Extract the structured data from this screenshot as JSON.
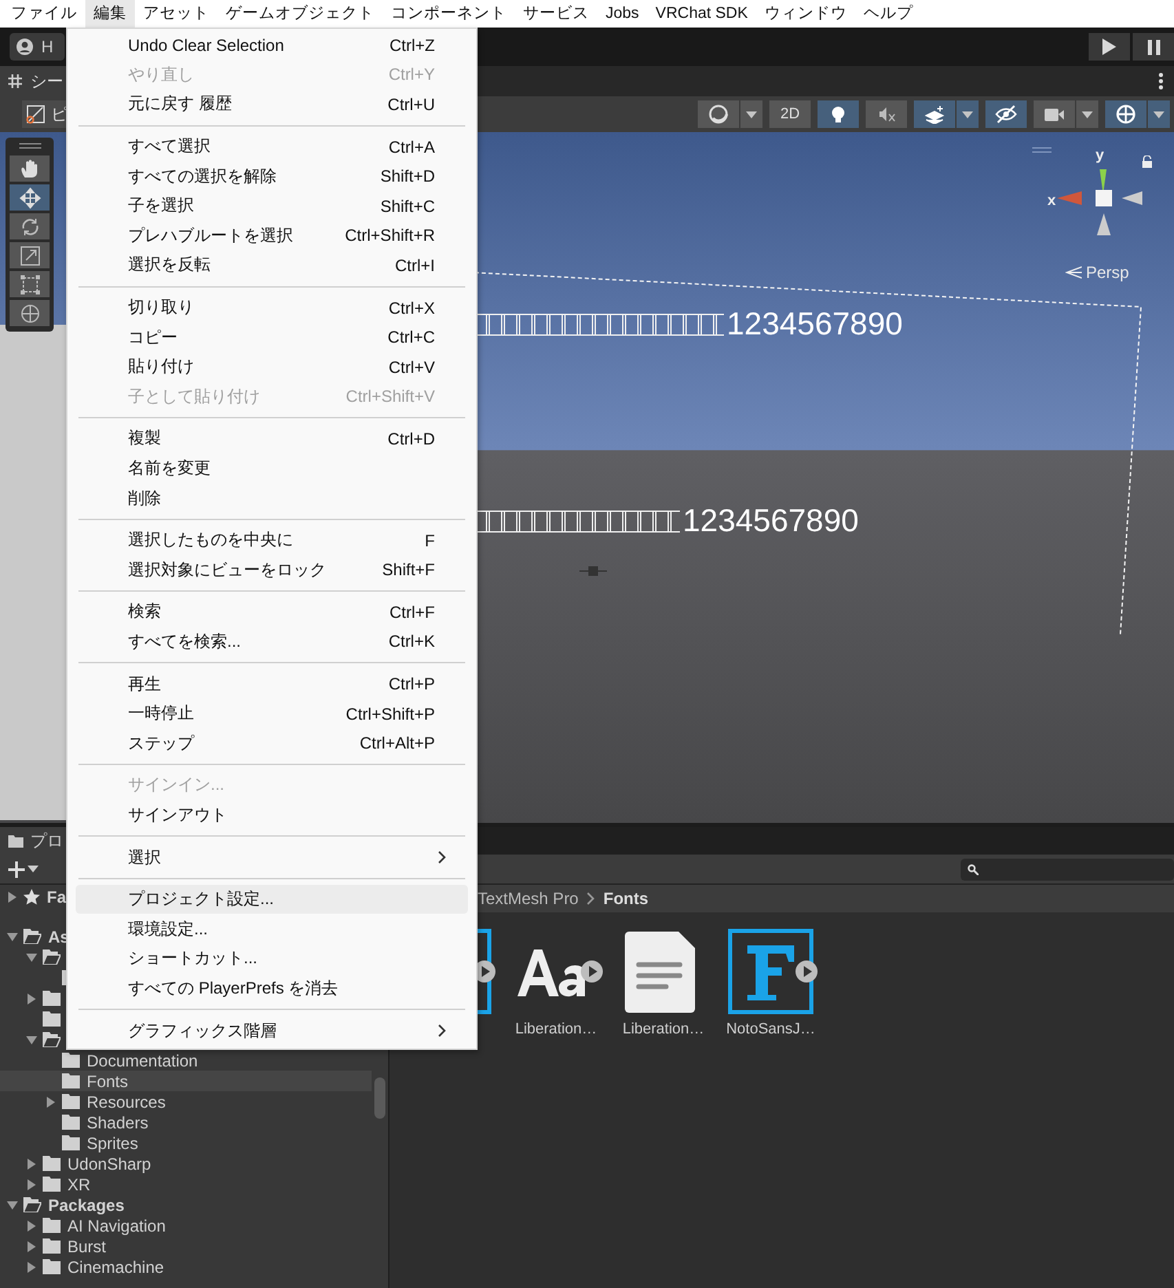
{
  "menubar": [
    {
      "label": "ファイル",
      "selected": false
    },
    {
      "label": "編集",
      "selected": true
    },
    {
      "label": "アセット",
      "selected": false
    },
    {
      "label": "ゲームオブジェクト",
      "selected": false
    },
    {
      "label": "コンポーネント",
      "selected": false
    },
    {
      "label": "サービス",
      "selected": false
    },
    {
      "label": "Jobs",
      "selected": false
    },
    {
      "label": "VRChat SDK",
      "selected": false
    },
    {
      "label": "ウィンドウ",
      "selected": false
    },
    {
      "label": "ヘルプ",
      "selected": false
    }
  ],
  "toolbar": {
    "account": "H"
  },
  "scene_tab": {
    "title": "シー"
  },
  "scene_toolbar": {
    "left_label": "ピ",
    "buttons": [
      {
        "kind": "shading",
        "on": false,
        "dropdown": true
      },
      {
        "kind": "text",
        "label": "2D",
        "on": false,
        "dropdown": false
      },
      {
        "kind": "light",
        "on": true,
        "dropdown": false
      },
      {
        "kind": "audio",
        "on": false,
        "dropdown": false
      },
      {
        "kind": "effects",
        "on": true,
        "dropdown": true
      },
      {
        "kind": "hidden",
        "on": true,
        "dropdown": false
      },
      {
        "kind": "camera",
        "on": false,
        "dropdown": true
      },
      {
        "kind": "gizmos",
        "on": true,
        "dropdown": true
      }
    ]
  },
  "tools": [
    {
      "kind": "hand",
      "selected": false
    },
    {
      "kind": "move",
      "selected": true
    },
    {
      "kind": "rotate",
      "selected": false
    },
    {
      "kind": "scale",
      "selected": false
    },
    {
      "kind": "rect",
      "selected": false
    },
    {
      "kind": "transform",
      "selected": false
    }
  ],
  "scene": {
    "texts": [
      {
        "text": "1234567890"
      },
      {
        "text": "1234567890"
      }
    ],
    "gizmo": {
      "y": "y",
      "x": "x",
      "view": "Persp"
    }
  },
  "edit_menu": {
    "groups": [
      {
        "items": [
          {
            "label": "Undo Clear Selection",
            "shortcut": "Ctrl+Z",
            "disabled": false,
            "highlighted": false,
            "submenu": false
          },
          {
            "label": "やり直し",
            "shortcut": "Ctrl+Y",
            "disabled": true,
            "highlighted": false,
            "submenu": false
          },
          {
            "label": "元に戻す 履歴",
            "shortcut": "Ctrl+U",
            "disabled": false,
            "highlighted": false,
            "submenu": false
          }
        ]
      },
      {
        "items": [
          {
            "label": "すべて選択",
            "shortcut": "Ctrl+A",
            "disabled": false,
            "highlighted": false,
            "submenu": false
          },
          {
            "label": "すべての選択を解除",
            "shortcut": "Shift+D",
            "disabled": false,
            "highlighted": false,
            "submenu": false
          },
          {
            "label": "子を選択",
            "shortcut": "Shift+C",
            "disabled": false,
            "highlighted": false,
            "submenu": false
          },
          {
            "label": "プレハブルートを選択",
            "shortcut": "Ctrl+Shift+R",
            "disabled": false,
            "highlighted": false,
            "submenu": false
          },
          {
            "label": "選択を反転",
            "shortcut": "Ctrl+I",
            "disabled": false,
            "highlighted": false,
            "submenu": false
          }
        ]
      },
      {
        "items": [
          {
            "label": "切り取り",
            "shortcut": "Ctrl+X",
            "disabled": false,
            "highlighted": false,
            "submenu": false
          },
          {
            "label": "コピー",
            "shortcut": "Ctrl+C",
            "disabled": false,
            "highlighted": false,
            "submenu": false
          },
          {
            "label": "貼り付け",
            "shortcut": "Ctrl+V",
            "disabled": false,
            "highlighted": false,
            "submenu": false
          },
          {
            "label": "子として貼り付け",
            "shortcut": "Ctrl+Shift+V",
            "disabled": true,
            "highlighted": false,
            "submenu": false
          }
        ]
      },
      {
        "items": [
          {
            "label": "複製",
            "shortcut": "Ctrl+D",
            "disabled": false,
            "highlighted": false,
            "submenu": false
          },
          {
            "label": "名前を変更",
            "disabled": false,
            "highlighted": false,
            "submenu": false
          },
          {
            "label": "削除",
            "disabled": false,
            "highlighted": false,
            "submenu": false
          }
        ]
      },
      {
        "items": [
          {
            "label": "選択したものを中央に",
            "shortcut": "F",
            "disabled": false,
            "highlighted": false,
            "submenu": false
          },
          {
            "label": "選択対象にビューをロック",
            "shortcut": "Shift+F",
            "disabled": false,
            "highlighted": false,
            "submenu": false
          }
        ]
      },
      {
        "items": [
          {
            "label": "検索",
            "shortcut": "Ctrl+F",
            "disabled": false,
            "highlighted": false,
            "submenu": false
          },
          {
            "label": "すべてを検索...",
            "shortcut": "Ctrl+K",
            "disabled": false,
            "highlighted": false,
            "submenu": false
          }
        ]
      },
      {
        "items": [
          {
            "label": "再生",
            "shortcut": "Ctrl+P",
            "disabled": false,
            "highlighted": false,
            "submenu": false
          },
          {
            "label": "一時停止",
            "shortcut": "Ctrl+Shift+P",
            "disabled": false,
            "highlighted": false,
            "submenu": false
          },
          {
            "label": "ステップ",
            "shortcut": "Ctrl+Alt+P",
            "disabled": false,
            "highlighted": false,
            "submenu": false
          }
        ]
      },
      {
        "items": [
          {
            "label": "サインイン...",
            "disabled": true,
            "highlighted": false,
            "submenu": false
          },
          {
            "label": "サインアウト",
            "disabled": false,
            "highlighted": false,
            "submenu": false
          }
        ]
      },
      {
        "items": [
          {
            "label": "選択",
            "disabled": false,
            "highlighted": false,
            "submenu": true
          }
        ]
      },
      {
        "items": [
          {
            "label": "プロジェクト設定...",
            "disabled": false,
            "highlighted": true,
            "submenu": false
          },
          {
            "label": "環境設定...",
            "disabled": false,
            "highlighted": false,
            "submenu": false
          },
          {
            "label": "ショートカット...",
            "disabled": false,
            "highlighted": false,
            "submenu": false
          },
          {
            "label": "すべての PlayerPrefs を消去",
            "disabled": false,
            "highlighted": false,
            "submenu": false
          }
        ]
      },
      {
        "items": [
          {
            "label": "グラフィックス階層",
            "disabled": false,
            "highlighted": false,
            "submenu": true
          }
        ]
      }
    ]
  },
  "project": {
    "tab": "プロ",
    "breadcrumb": [
      "TextMesh Pro",
      "Fonts"
    ],
    "tree": [
      {
        "label": "Fa",
        "kind": "favorites",
        "expanded": false,
        "selected": false
      },
      {
        "label": "As",
        "kind": "folder",
        "expanded": true,
        "selected": false,
        "children": [
          {
            "kind": "folder",
            "expanded": true,
            "selected": false,
            "children": [
              {
                "kind": "folder",
                "selected": false
              }
            ]
          },
          {
            "kind": "folder",
            "expanded": false,
            "selected": false
          },
          {
            "kind": "folder",
            "selected": false
          },
          {
            "kind": "folder",
            "expanded": true,
            "selected": false,
            "children": [
              {
                "label": "Documentation",
                "kind": "folder",
                "selected": false
              },
              {
                "label": "Fonts",
                "kind": "folder",
                "selected": true
              },
              {
                "label": "Resources",
                "kind": "folder",
                "expanded": false,
                "selected": false
              },
              {
                "label": "Shaders",
                "kind": "folder",
                "selected": false
              },
              {
                "label": "Sprites",
                "kind": "folder",
                "selected": false
              }
            ]
          },
          {
            "label": "UdonSharp",
            "kind": "folder",
            "expanded": false,
            "selected": false
          },
          {
            "label": "XR",
            "kind": "folder",
            "expanded": false,
            "selected": false
          }
        ]
      },
      {
        "label": "Packages",
        "kind": "folder",
        "expanded": true,
        "selected": false,
        "children": [
          {
            "label": "AI Navigation",
            "kind": "folder",
            "expanded": false,
            "selected": false
          },
          {
            "label": "Burst",
            "kind": "folder",
            "expanded": false,
            "selected": false
          },
          {
            "label": "Cinemachine",
            "kind": "folder",
            "expanded": false,
            "selected": false
          }
        ]
      }
    ],
    "assets": [
      {
        "kind": "font-asset",
        "expanded": false
      },
      {
        "kind": "font-file",
        "label": "Liberation…",
        "expanded": false
      },
      {
        "kind": "text-file",
        "label": "Liberation…"
      },
      {
        "kind": "font-asset",
        "label": "NotoSansJ…",
        "expanded": false
      }
    ]
  }
}
